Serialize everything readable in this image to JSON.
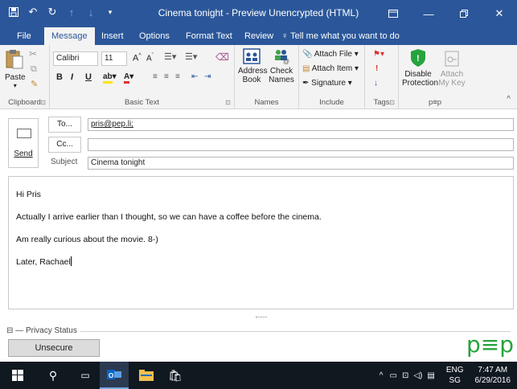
{
  "window": {
    "title": "Cinema tonight - Preview Unencrypted (HTML)"
  },
  "qat": {
    "save_icon": "save-icon",
    "undo_icon": "undo-icon",
    "redo_icon": "redo-icon"
  },
  "tabs": [
    {
      "label": "File"
    },
    {
      "label": "Message"
    },
    {
      "label": "Insert"
    },
    {
      "label": "Options"
    },
    {
      "label": "Format Text"
    },
    {
      "label": "Review"
    }
  ],
  "tell_me": "Tell me what you want to do",
  "ribbon": {
    "clipboard": {
      "paste": "Paste",
      "label": "Clipboard"
    },
    "basic_text": {
      "font": "Calibri",
      "size": "11",
      "label": "Basic Text",
      "bold": "B",
      "italic": "I",
      "underline": "U"
    },
    "names": {
      "address_book_1": "Address",
      "address_book_2": "Book",
      "check_names_1": "Check",
      "check_names_2": "Names",
      "label": "Names"
    },
    "include": {
      "attach_file": "Attach File",
      "attach_item": "Attach Item",
      "signature": "Signature",
      "label": "Include"
    },
    "tags": {
      "label": "Tags"
    },
    "pep": {
      "disable_1": "Disable",
      "disable_2": "Protection",
      "attach_key_1": "Attach",
      "attach_key_2": "My Key",
      "label": "p≡p"
    }
  },
  "compose": {
    "send": "Send",
    "to_button": "To...",
    "cc_button": "Cc...",
    "subject_label": "Subject",
    "to_value": "pris@pep.li;",
    "cc_value": "",
    "subject_value": "Cinema tonight"
  },
  "body": {
    "lines": [
      "Hi Pris",
      "Actually I arrive earlier than I thought, so we can have a coffee before the cinema.",
      "Am really curious about the movie. 8-)",
      "Later, Rachael"
    ]
  },
  "privacy": {
    "label": "Privacy Status",
    "status_button": "Unsecure",
    "logo": "p≡p",
    "logo_color": "#27a33d"
  },
  "taskbar": {
    "lang_1": "ENG",
    "lang_2": "SG",
    "time": "7:47 AM",
    "date": "6/29/2016"
  },
  "colors": {
    "accent": "#2b579a",
    "taskbar": "#101820"
  }
}
